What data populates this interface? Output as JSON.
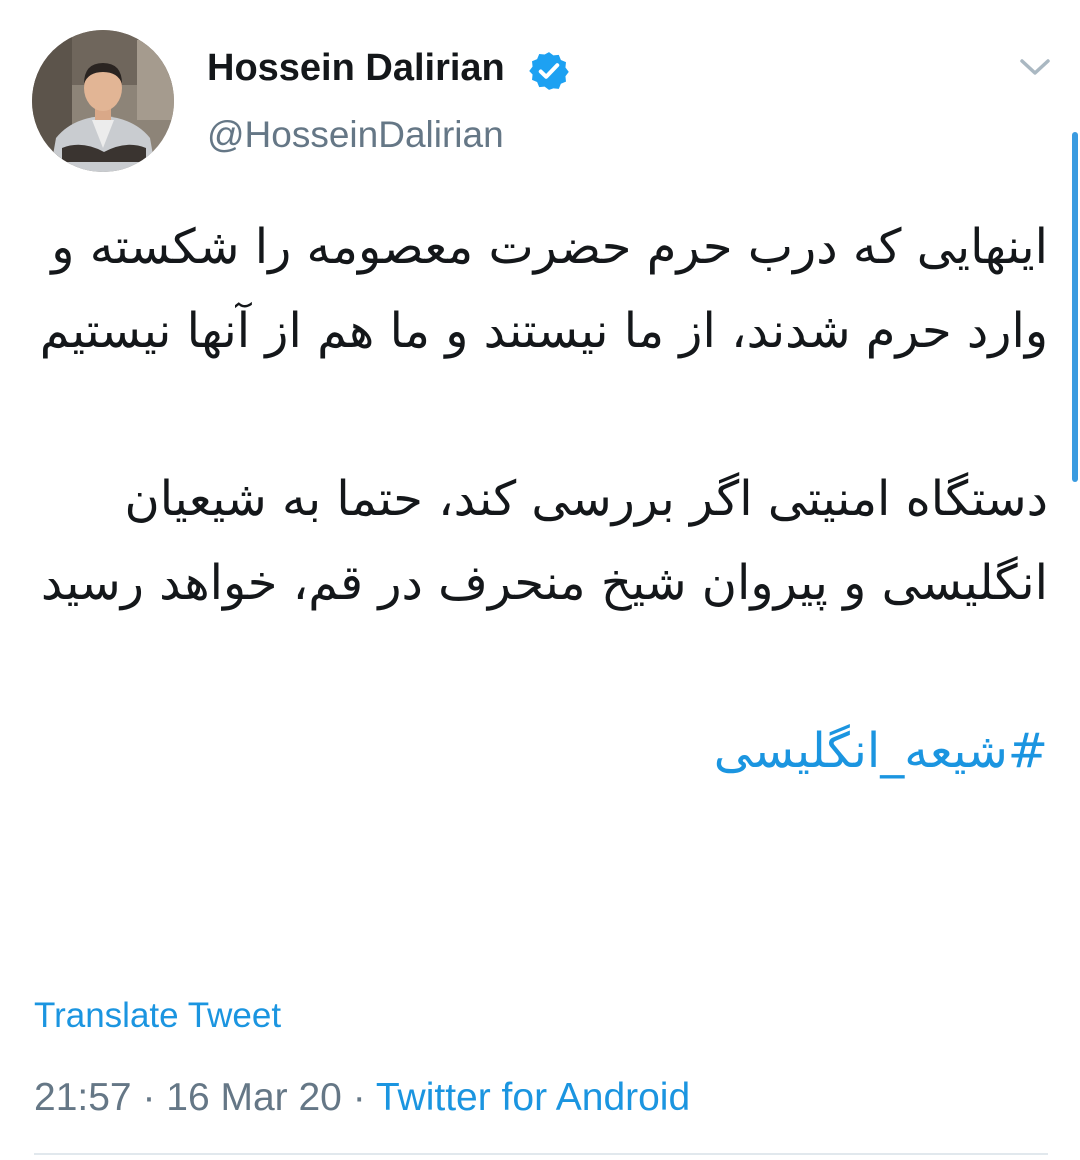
{
  "tweet": {
    "author": {
      "name": "Hossein Dalirian",
      "handle": "@HosseinDalirian",
      "verified": true
    },
    "paragraphs": [
      "اینهایی که درب حرم حضرت معصومه را شکسته و وارد حرم شدند، از ما نیستند و ما هم از آنها نیستیم",
      "دستگاه امنیتی اگر بررسی کند، حتما به شیعیان انگلیسی و پیروان شیخ منحرف در قم، خواهد رسید"
    ],
    "hashtag": "#شیعه_انگلیسی",
    "translate_label": "Translate Tweet",
    "meta": {
      "time": "21:57",
      "separator": " · ",
      "date": "16 Mar 20",
      "source": "Twitter for Android"
    }
  },
  "icons": {
    "verified": "verified-badge-icon",
    "menu": "chevron-down-icon"
  },
  "colors": {
    "accent": "#1b95e0",
    "text": "#14171a",
    "secondary": "#657786",
    "scrollbar": "#3a9be0"
  }
}
